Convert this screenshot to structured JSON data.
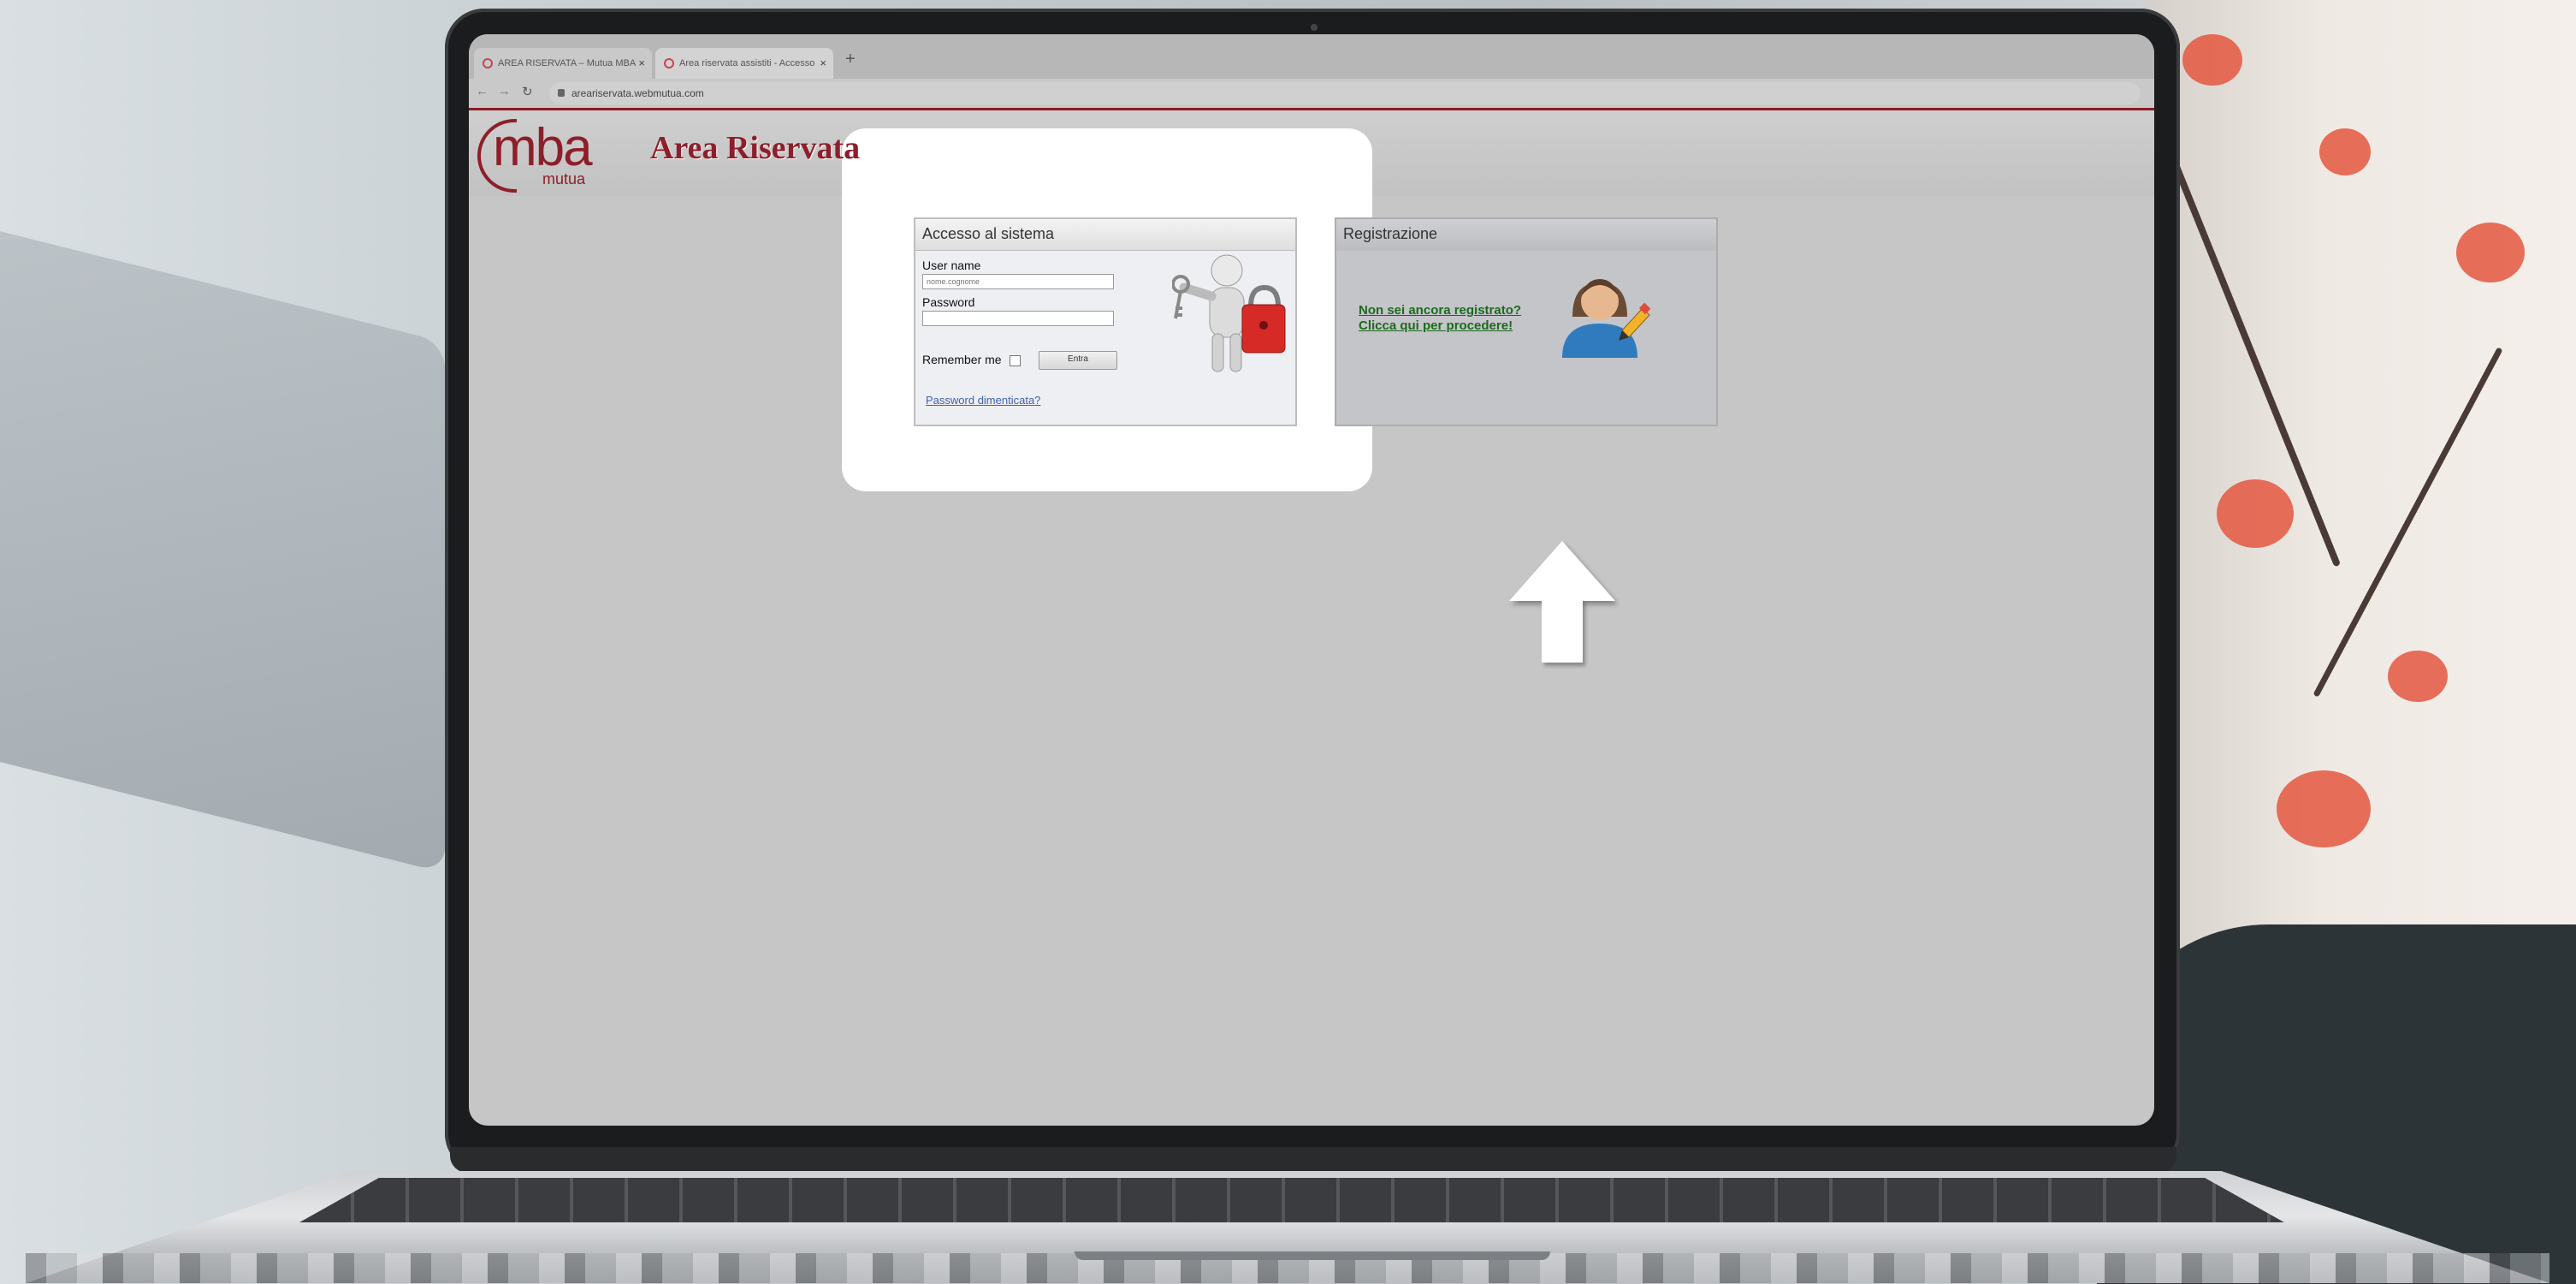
{
  "browser": {
    "tabs": [
      {
        "title": "AREA RISERVATA – Mutua MBA",
        "active": false
      },
      {
        "title": "Area riservata assistiti - Accesso",
        "active": true
      }
    ],
    "new_tab_label": "+",
    "close_label": "×",
    "url": "areariservata.webmutua.com"
  },
  "site": {
    "logo_main": "mba",
    "logo_sub": "mutua",
    "title": "Area Riservata"
  },
  "login": {
    "heading": "Accesso al sistema",
    "username_label": "User name",
    "username_placeholder": "nome.cognome",
    "password_label": "Password",
    "remember_label": "Remember me",
    "submit_label": "Entra",
    "forgot_link": "Password dimenticata?"
  },
  "registration": {
    "heading": "Registrazione",
    "line1": "Non sei ancora registrato?",
    "line2": "Clicca qui per procedere!"
  },
  "colors": {
    "brand": "#8d1f2a",
    "link_green": "#1d6a1d",
    "link_blue": "#3f61b0",
    "highlight": "#ffffff"
  }
}
